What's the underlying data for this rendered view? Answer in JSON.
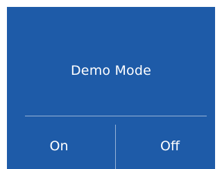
{
  "dialog": {
    "title": "Demo Mode",
    "options": {
      "on_label": "On",
      "off_label": "Off"
    }
  },
  "colors": {
    "panel_background": "#1e5ba8",
    "text": "#ffffff",
    "page_background": "#ffffff"
  }
}
